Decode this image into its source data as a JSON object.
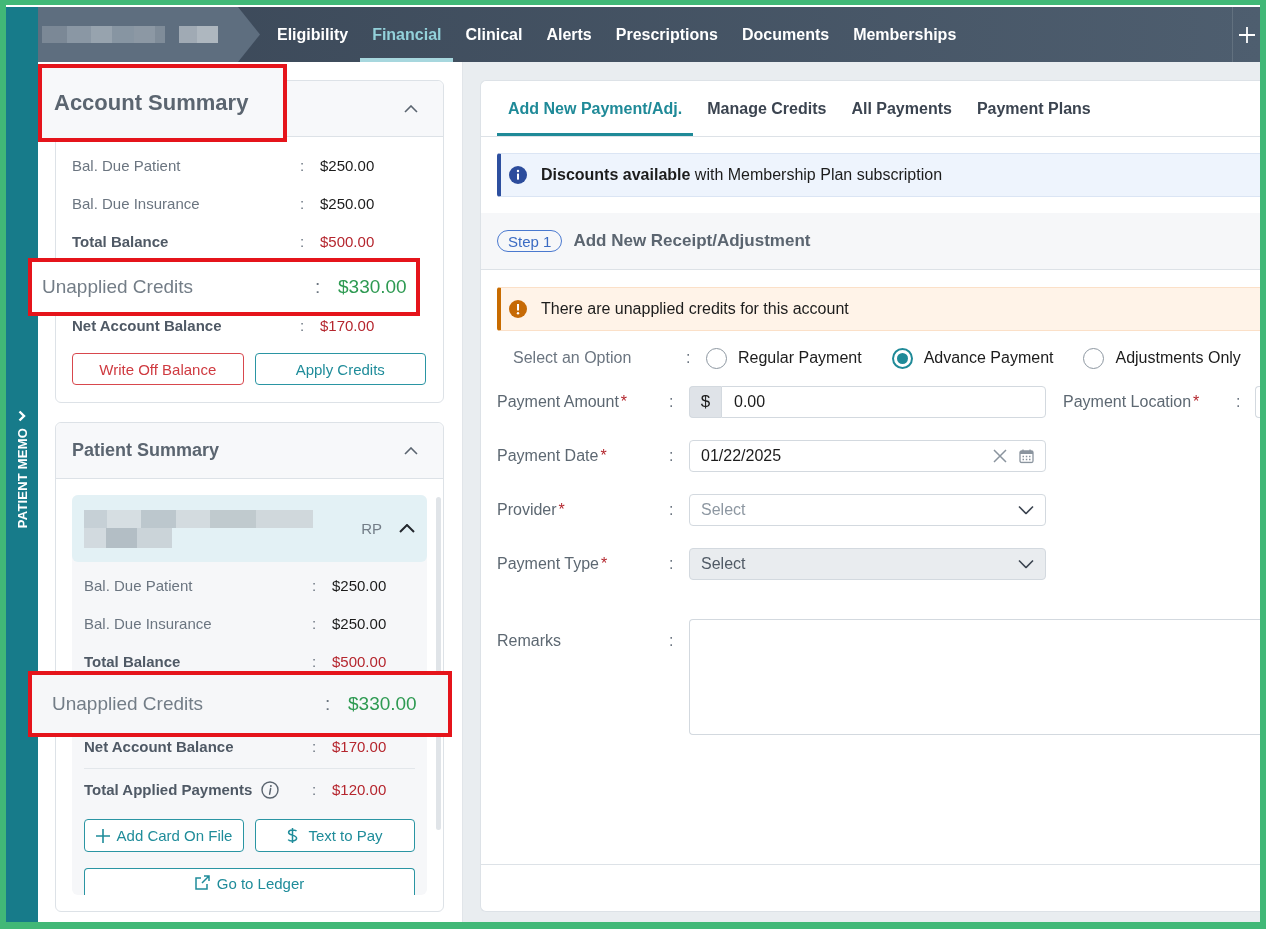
{
  "patient_memo": {
    "label": "PATIENT MEMO"
  },
  "top_nav": {
    "tabs": [
      {
        "label": "Eligibility",
        "selected": false
      },
      {
        "label": "Financial",
        "selected": true
      },
      {
        "label": "Clinical",
        "selected": false
      },
      {
        "label": "Alerts",
        "selected": false
      },
      {
        "label": "Prescriptions",
        "selected": false
      },
      {
        "label": "Documents",
        "selected": false
      },
      {
        "label": "Memberships",
        "selected": false
      }
    ]
  },
  "account_summary": {
    "title": "Account Summary",
    "highlighted": true,
    "expanded": true,
    "rows": [
      {
        "label": "Bal. Due Patient",
        "separator": ":",
        "value": "$250.00",
        "kind": "detail",
        "highlighted": false
      },
      {
        "label": "Bal. Due Insurance",
        "separator": ":",
        "value": "$250.00",
        "kind": "detail",
        "highlighted": false
      },
      {
        "label": "Total Balance",
        "separator": ":",
        "value": "$500.00",
        "kind": "total",
        "highlighted": false
      },
      {
        "label": "Unapplied Credits",
        "separator": ":",
        "value": "$330.00",
        "kind": "credit",
        "highlighted": true
      },
      {
        "label": "Net Account Balance",
        "separator": ":",
        "value": "$170.00",
        "kind": "total",
        "highlighted": false
      }
    ],
    "buttons": [
      {
        "label": "Write Off Balance",
        "kind": "danger"
      },
      {
        "label": "Apply Credits",
        "kind": "primary"
      }
    ]
  },
  "patient_summary": {
    "title": "Patient Summary",
    "highlighted": false,
    "expanded": true,
    "patient": {
      "tag": "RP",
      "expanded": true
    },
    "rows": [
      {
        "label": "Bal. Due Patient",
        "separator": ":",
        "value": "$250.00",
        "kind": "detail",
        "highlighted": false
      },
      {
        "label": "Bal. Due Insurance",
        "separator": ":",
        "value": "$250.00",
        "kind": "detail",
        "highlighted": false
      },
      {
        "label": "Total Balance",
        "separator": ":",
        "value": "$500.00",
        "kind": "total",
        "highlighted": false
      },
      {
        "label": "Unapplied Credits",
        "separator": ":",
        "value": "$330.00",
        "kind": "credit",
        "highlighted": true
      },
      {
        "label": "Net Account Balance",
        "separator": ":",
        "value": "$170.00",
        "kind": "total",
        "highlighted": false
      },
      {
        "label": "Total Applied Payments",
        "separator": ":",
        "value": "$120.00",
        "kind": "applied",
        "highlighted": false
      }
    ],
    "buttons": [
      {
        "label": "Add Card On File",
        "kind": "add"
      },
      {
        "label": "Text to Pay",
        "kind": "pay"
      },
      {
        "label": "Go to Ledger",
        "kind": "ledger"
      }
    ]
  },
  "payment_panel": {
    "tabs": [
      {
        "label": "Add New Payment/Adj.",
        "selected": true
      },
      {
        "label": "Manage Credits",
        "selected": false
      },
      {
        "label": "All Payments",
        "selected": false
      },
      {
        "label": "Payment Plans",
        "selected": false
      }
    ],
    "notice": {
      "kind": "info",
      "text": "**Discounts available** with Membership Plan subscription"
    },
    "step": {
      "badge": "Step 1",
      "title": "Add New Receipt/Adjustment"
    },
    "alert": {
      "kind": "warning",
      "text": "There are unapplied credits for this account"
    },
    "option": {
      "label": "Select an Option",
      "separator": ":",
      "choices": [
        {
          "label": "Regular Payment",
          "selected": false
        },
        {
          "label": "Advance Payment",
          "selected": true
        },
        {
          "label": "Adjustments Only",
          "selected": false
        }
      ]
    },
    "form_rows": [
      {
        "fields": [
          {
            "label": "Payment Amount",
            "required_mark": "*",
            "separator": ":",
            "kind": "amount",
            "prefix": "$",
            "value": "0.00"
          },
          {
            "label": "Payment Location",
            "required_mark": "*",
            "separator": ":",
            "kind": "text"
          }
        ]
      },
      {
        "fields": [
          {
            "label": "Payment Date",
            "required_mark": "*",
            "separator": ":",
            "kind": "date",
            "value": "01/22/2025"
          }
        ]
      },
      {
        "fields": [
          {
            "label": "Provider",
            "required_mark": "*",
            "separator": ":",
            "kind": "select",
            "placeholder": "Select",
            "disabled": false
          }
        ]
      },
      {
        "fields": [
          {
            "label": "Payment Type",
            "required_mark": "*",
            "separator": ":",
            "kind": "select",
            "placeholder": "Select",
            "disabled": true
          }
        ]
      },
      {
        "fields": [
          {
            "label": "Remarks",
            "separator": ":",
            "kind": "textarea"
          }
        ]
      }
    ]
  }
}
